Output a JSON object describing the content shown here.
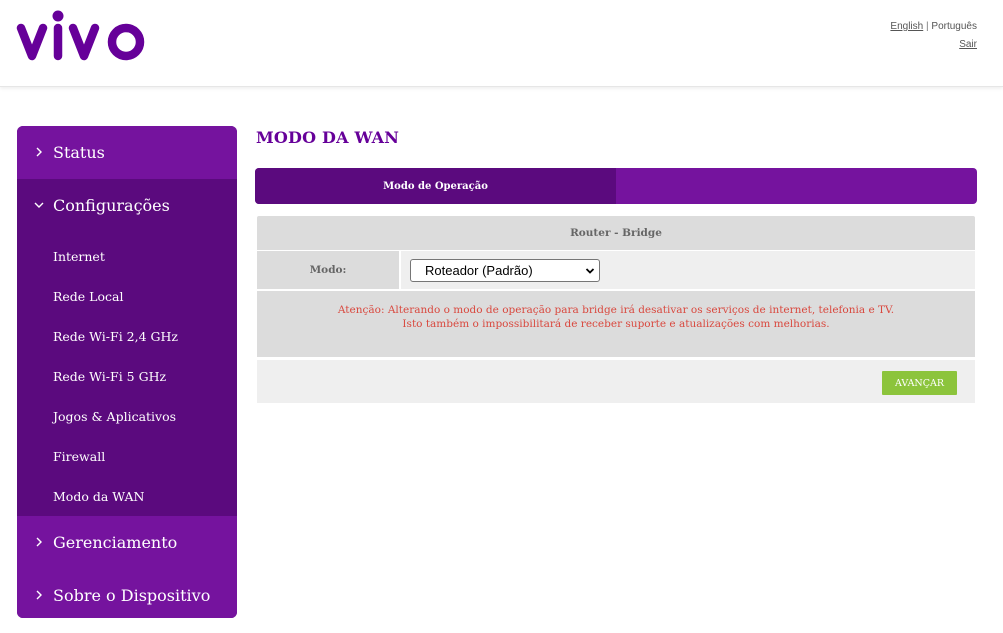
{
  "header": {
    "logo_text": "vivo",
    "lang_english": "English",
    "lang_separator": "|",
    "lang_portugues": "Português",
    "logout": "Sair"
  },
  "sidebar": {
    "status": "Status",
    "configuracoes": "Configurações",
    "sub_items": [
      "Internet",
      "Rede Local",
      "Rede Wi-Fi 2,4 GHz",
      "Rede Wi-Fi 5 GHz",
      "Jogos & Aplicativos",
      "Firewall",
      "Modo da WAN"
    ],
    "gerenciamento": "Gerenciamento",
    "sobre": "Sobre o Dispositivo"
  },
  "main": {
    "title": "MODO DA WAN",
    "tab_active": "Modo de Operação",
    "section_header": "Router - Bridge",
    "mode_label": "Modo:",
    "mode_value": "Roteador (Padrão)",
    "warning_line1": "Atenção: Alterando o modo de operação para bridge irá desativar os serviços de internet, telefonia e TV.",
    "warning_line2": "Isto também o impossibilitará de receber suporte e atualizações com melhorias.",
    "next_button": "AVANÇAR"
  },
  "colors": {
    "brand_purple": "#660099",
    "menu_purple": "#75139e",
    "menu_dark": "#5b0a7e",
    "button_green": "#8cc43c",
    "warning_red": "#d9493f"
  },
  "icons": [
    "chevron-right-icon",
    "chevron-down-icon",
    "select-caret-icon"
  ]
}
